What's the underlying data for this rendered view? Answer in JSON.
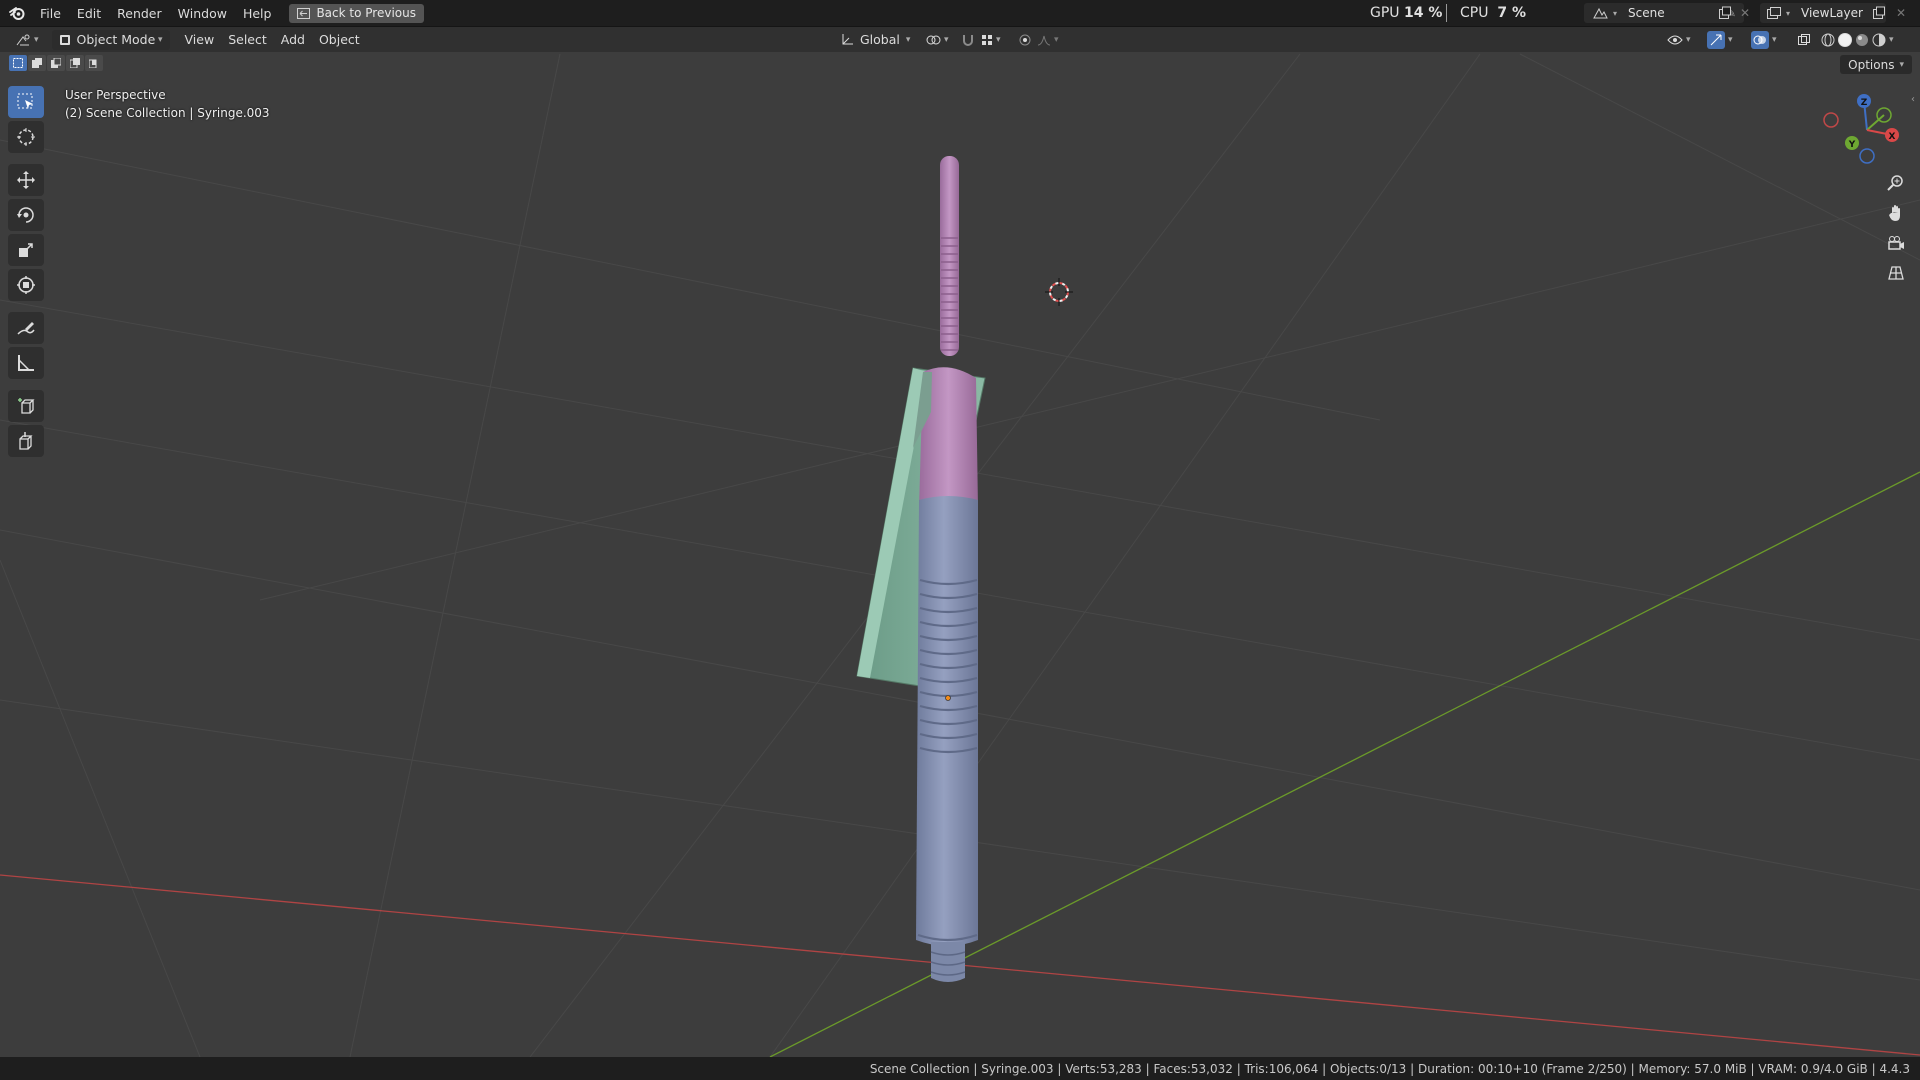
{
  "menu": {
    "items": [
      "File",
      "Edit",
      "Render",
      "Window",
      "Help"
    ],
    "back_button": "Back to Previous"
  },
  "stats": {
    "gpu_label": "GPU",
    "gpu_value": "14 %",
    "cpu_label": "CPU",
    "cpu_value": "7 %"
  },
  "scene_field": "Scene",
  "viewlayer_field": "ViewLayer",
  "header": {
    "mode": "Object Mode",
    "menus": [
      "View",
      "Select",
      "Add",
      "Object"
    ],
    "transform_orientation": "Global",
    "options": "Options"
  },
  "viewport": {
    "perspective": "User Perspective",
    "collection": "(2) Scene Collection | Syringe.003"
  },
  "gizmo": {
    "x": "X",
    "y": "Y",
    "z": "Z"
  },
  "statusbar": {
    "text": "Scene Collection | Syringe.003 | Verts:53,283 | Faces:53,032 | Tris:106,064 | Objects:0/13 | Duration: 00:10+10 (Frame 2/250) | Memory: 57.0 MiB | VRAM: 0.9/4.0 GiB | 4.4.3"
  },
  "colors": {
    "accent": "#4772b3",
    "plunger": "#b887b8",
    "barrel": "#8591b3",
    "flange": "#7aaa96",
    "x_axis": "#c04848",
    "y_axis": "#6e9a2e"
  },
  "icons": {
    "logo": "blender-logo-icon",
    "tools": [
      "select-box-icon",
      "cursor-icon",
      "move-icon",
      "rotate-icon",
      "scale-icon",
      "transform-icon",
      "annotate-icon",
      "measure-icon",
      "add-cube-icon",
      "extrude-cube-icon"
    ]
  }
}
